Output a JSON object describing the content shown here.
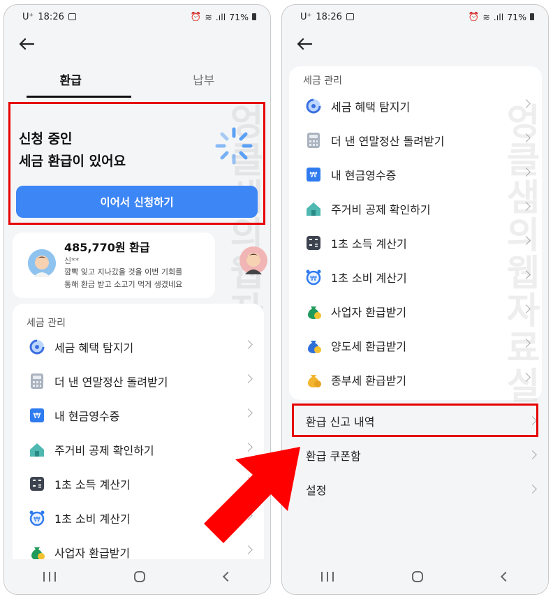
{
  "status_bar": {
    "carrier": "U⁺",
    "time": "18:26",
    "battery": "71%"
  },
  "left_screen": {
    "tabs": [
      "환급",
      "납부"
    ],
    "apply_card": {
      "title_line1": "신청 중인",
      "title_line2": "세금 환급이 있어요",
      "button": "이어서 신청하기"
    },
    "refund_card": {
      "amount": "485,770원 환급",
      "name": "신**",
      "desc_line1": "깜빡 잊고 지나갔을 것을 이번 기회를",
      "desc_line2": "통해 환급 받고 소고기 먹게 생겼네요"
    },
    "section_title": "세금 관리",
    "items": [
      {
        "label": "세금 혜택 탐지기",
        "icon": "spiral-icon"
      },
      {
        "label": "더 낸 연말정산 돌려받기",
        "icon": "calculator-icon"
      },
      {
        "label": "내 현금영수증",
        "icon": "receipt-icon"
      },
      {
        "label": "주거비 공제 확인하기",
        "icon": "house-icon"
      },
      {
        "label": "1초 소득 계산기",
        "icon": "calc-dark-icon"
      },
      {
        "label": "1초 소비 계산기",
        "icon": "alarm-won-icon"
      },
      {
        "label": "사업자 환급받기",
        "icon": "money-bag-icon"
      }
    ]
  },
  "right_screen": {
    "section_title": "세금 관리",
    "items": [
      {
        "label": "세금 혜택 탐지기",
        "icon": "spiral-icon"
      },
      {
        "label": "더 낸 연말정산 돌려받기",
        "icon": "calculator-icon"
      },
      {
        "label": "내 현금영수증",
        "icon": "receipt-icon"
      },
      {
        "label": "주거비 공제 확인하기",
        "icon": "house-icon"
      },
      {
        "label": "1초 소득 계산기",
        "icon": "calc-dark-icon"
      },
      {
        "label": "1초 소비 계산기",
        "icon": "alarm-won-icon"
      },
      {
        "label": "사업자 환급받기",
        "icon": "money-bag-icon"
      },
      {
        "label": "양도세 환급받기",
        "icon": "money-bag-blue-icon"
      },
      {
        "label": "종부세 환급받기",
        "icon": "money-bag-yellow-icon"
      }
    ],
    "plain_items": [
      "환급 신고 내역",
      "환급 쿠폰함",
      "설정"
    ]
  },
  "watermark": "엉클샘의웹자료실",
  "colors": {
    "accent": "#3d86f5",
    "highlight": "#e60000",
    "arrow": "#ff0000"
  }
}
